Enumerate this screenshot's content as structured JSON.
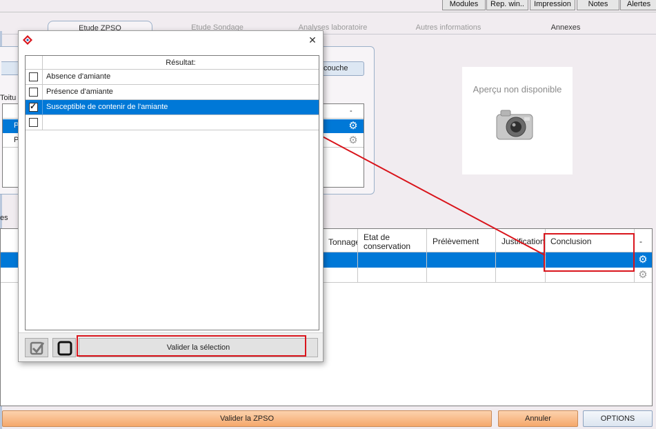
{
  "topbar": {
    "buttons": [
      "Modules",
      "Rep. win..",
      "Impression",
      "Notes",
      "Alertes"
    ]
  },
  "tabs": [
    "Etude ZPSO",
    "Etude Sondage",
    "Analyses laboratoire",
    "Autres informations",
    "Annexes"
  ],
  "background": {
    "couche_button": "couche",
    "toiture_label": "Toitu",
    "p_letter": "P",
    "es_label": "es",
    "preview_text": "Aperçu non disponible",
    "grid_headers": {
      "tonnage": "Tonnage",
      "etat": "Etat de conservation",
      "prelevement": "Prélèvement",
      "justification": "Justification",
      "conclusion": "Conclusion",
      "dash": "-"
    },
    "small_dash": "-"
  },
  "dialog": {
    "close_glyph": "✕",
    "list_header": "Résultat:",
    "items": [
      {
        "label": "Absence d'amiante",
        "checked": false
      },
      {
        "label": "Présence d'amiante",
        "checked": false
      },
      {
        "label": "Susceptible de contenir de l'amiante",
        "checked": true
      },
      {
        "label": "",
        "checked": false
      }
    ],
    "validate_label": "Valider la sélection"
  },
  "footer": {
    "validate_zpso": "Valider la ZPSO",
    "cancel": "Annuler",
    "options": "OPTIONS"
  },
  "colors": {
    "selection": "#0078d7",
    "annotation": "#d9141b",
    "orange": "#f7b27a"
  }
}
